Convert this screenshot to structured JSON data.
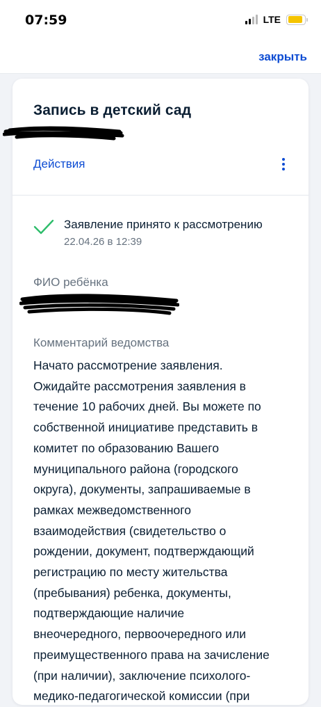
{
  "status_bar": {
    "time": "07:59",
    "network": "LTE",
    "icons": [
      "signal-icon",
      "battery-icon"
    ],
    "battery_level": 0.9
  },
  "nav": {
    "close_label": "закрыть"
  },
  "card": {
    "title": "Запись в детский сад",
    "actions_label": "Действия",
    "status": {
      "text": "Заявление принято к рассмотрению",
      "date": "22.04.26 в 12:39",
      "icon": "check-icon"
    },
    "child_label": "ФИО ребёнка",
    "comment_label": "Комментарий ведомства",
    "comment_lines": [
      "Начато рассмотрение заявления.",
      "Ожидайте рассмотрения заявления в",
      "течение 10 рабочих дней. Вы можете по",
      "собственной инициативе представить в",
      "комитет по образованию Вашего",
      "муниципального района (городского",
      "округа), документы, запрашиваемые в",
      "рамках межведомственного",
      "взаимодействия (свидетельство о",
      "рождении, документ, подтверждающий",
      "регистрацию по месту жительства",
      "(пребывания) ребенка, документы,",
      "подтверждающие наличие",
      "внеочередного, первоочередного или",
      "преимущественного права на зачисление",
      "(при наличии), заключение психолого-",
      "медико-педагогической комиссии (при"
    ]
  },
  "colors": {
    "accent": "#0d4cd3",
    "success": "#2ebd6b",
    "text": "#0b1f33",
    "muted": "#66727f",
    "background": "#f1f3f7"
  }
}
